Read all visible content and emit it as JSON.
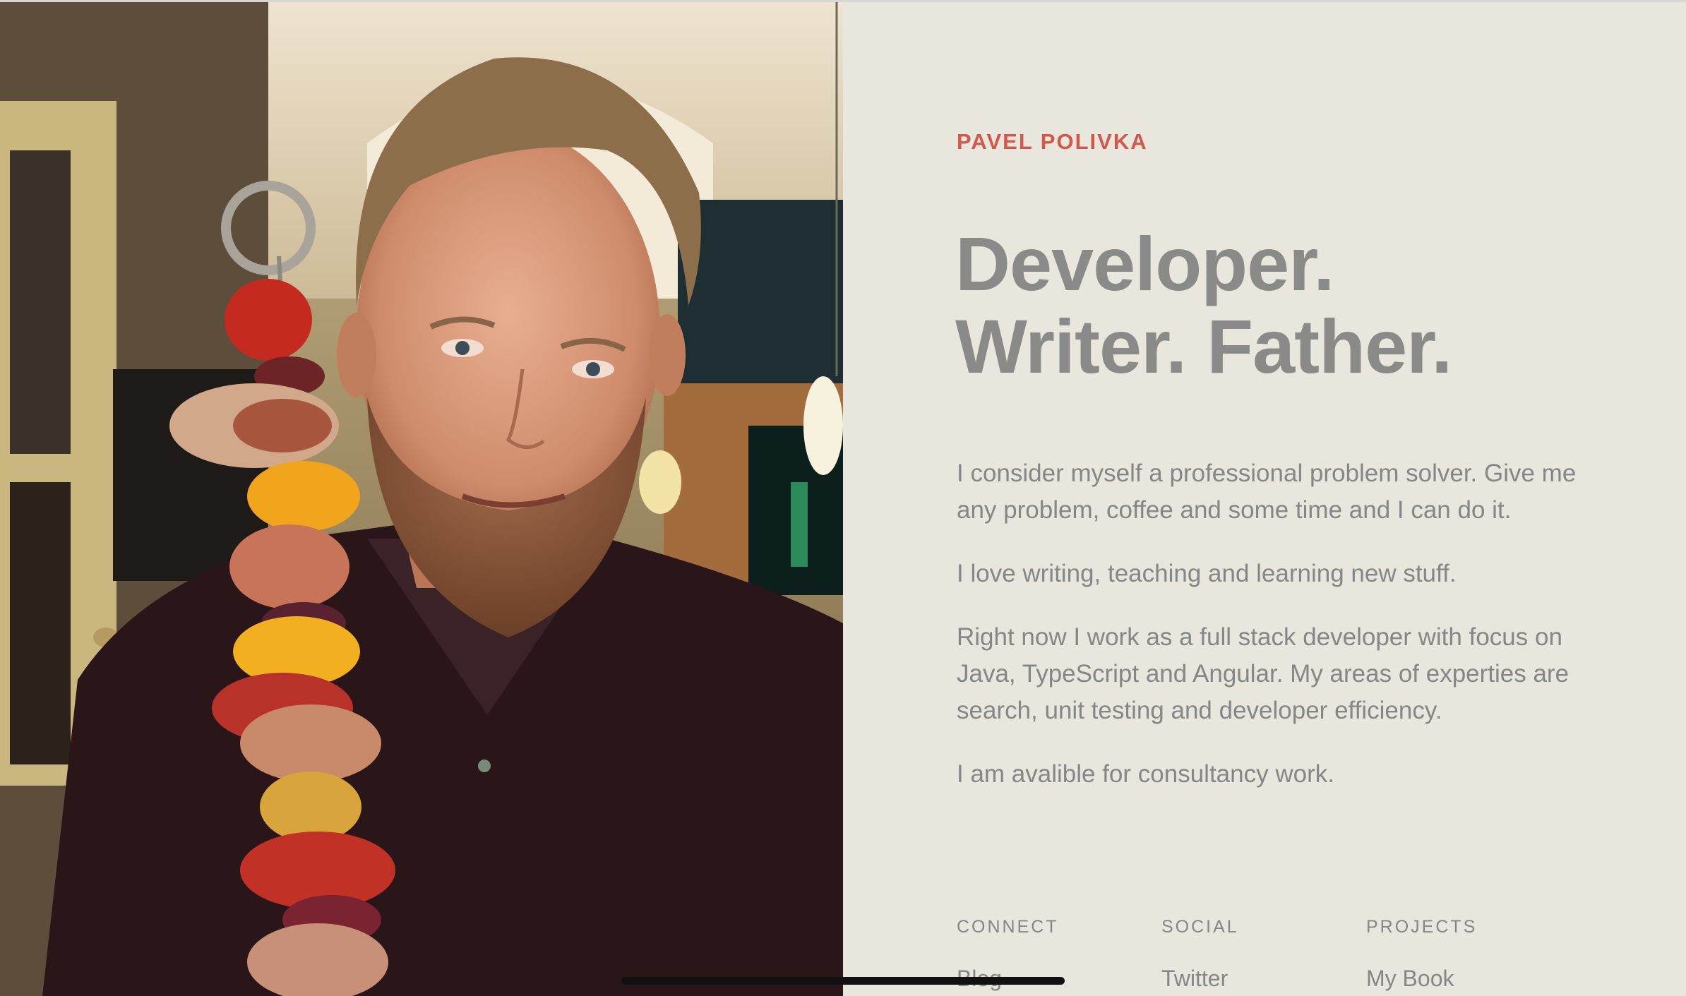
{
  "profile": {
    "name": "PAVEL POLIVKA",
    "headline_line1": "Developer.",
    "headline_line2": "Writer. Father.",
    "photo_alt": "Pavel Polivka holding a meat skewer"
  },
  "bio": {
    "paragraphs": [
      "I consider myself a professional problem solver. Give me any problem, coffee and some time and I can do it.",
      "I love writing, teaching and learning new stuff.",
      "Right now I work as a full stack developer with focus on Java, TypeScript and Angular. My areas of experties are search, unit testing and developer efficiency.",
      "I am avalible for consultancy work."
    ]
  },
  "footer": {
    "columns": [
      {
        "heading": "CONNECT",
        "links": [
          "Blog"
        ]
      },
      {
        "heading": "SOCIAL",
        "links": [
          "Twitter"
        ]
      },
      {
        "heading": "PROJECTS",
        "links": [
          "My Book"
        ]
      }
    ]
  },
  "colors": {
    "background": "#e9e6de",
    "accent": "#d1584c",
    "text": "#858686",
    "headline": "#8a8a88"
  }
}
